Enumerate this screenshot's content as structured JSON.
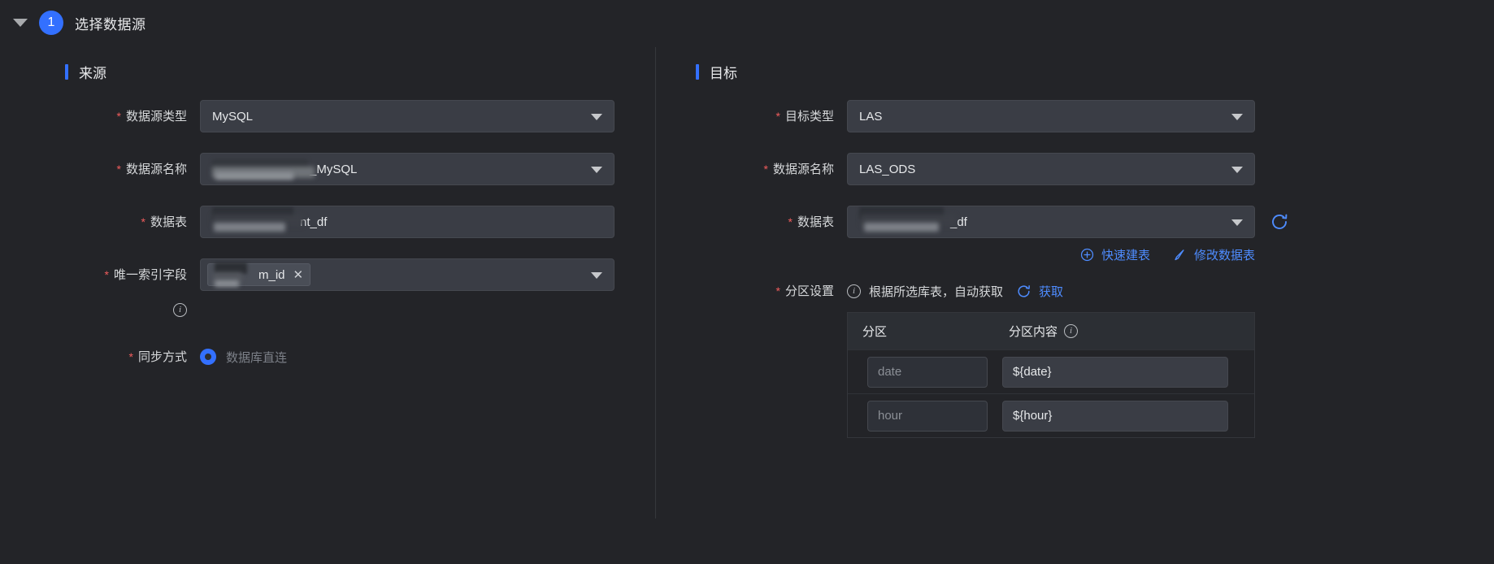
{
  "step": {
    "number": "1",
    "title": "选择数据源",
    "collapse_icon": "caret-down-icon"
  },
  "source": {
    "section_title": "来源",
    "rows": {
      "datasource_type": {
        "label": "数据源类型",
        "required": "*",
        "value": "MySQL"
      },
      "datasource_name": {
        "label": "数据源名称",
        "required": "*",
        "value_suffix": "_MySQL",
        "redacted": true
      },
      "data_table": {
        "label": "数据表",
        "required": "*",
        "value_suffix": "nt_df",
        "redacted": true
      },
      "unique_index": {
        "label": "唯一索引字段",
        "required": "*",
        "tag_suffix": "m_id",
        "tag_close": "✕",
        "redacted": true,
        "info_icon": "info-circle-icon"
      },
      "sync_mode": {
        "label": "同步方式",
        "required": "*",
        "option": "数据库直连",
        "selected": true
      }
    }
  },
  "target": {
    "section_title": "目标",
    "rows": {
      "target_type": {
        "label": "目标类型",
        "required": "*",
        "value": "LAS"
      },
      "datasource_name": {
        "label": "数据源名称",
        "required": "*",
        "value": "LAS_ODS"
      },
      "data_table": {
        "label": "数据表",
        "required": "*",
        "value_suffix": "_df",
        "redacted": true,
        "refresh_icon": "refresh-icon"
      },
      "partition_settings": {
        "label": "分区设置",
        "required": "*"
      }
    },
    "links": {
      "quick_create": {
        "label": "快速建表",
        "icon": "plus-circle-icon"
      },
      "modify_table": {
        "label": "修改数据表",
        "icon": "pencil-icon"
      }
    },
    "partition_hint": {
      "icon": "info-circle-icon",
      "text": "根据所选库表，自动获取",
      "fetch_label": "获取",
      "fetch_icon": "refresh-icon"
    },
    "partition_table": {
      "headers": [
        "分区",
        "分区内容"
      ],
      "header_info_icon": "info-circle-icon",
      "rows": [
        {
          "key_placeholder": "date",
          "value": "${date}"
        },
        {
          "key_placeholder": "hour",
          "value": "${hour}"
        }
      ]
    }
  },
  "colors": {
    "accent": "#3370ff",
    "link": "#4e8cff",
    "required": "#f05c5c",
    "background": "#232428",
    "field_bg": "#3a3d45"
  }
}
